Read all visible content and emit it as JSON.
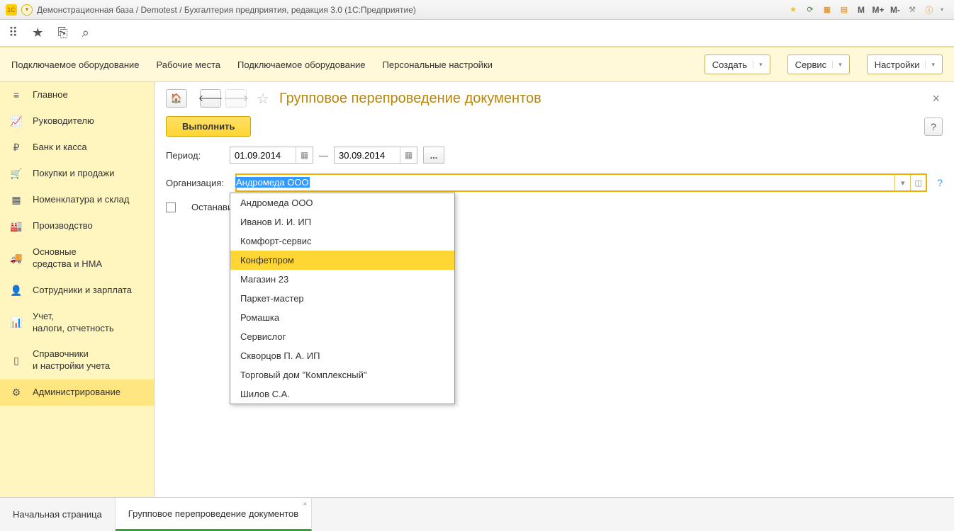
{
  "title": "Демонстрационная база / Demotest / Бухгалтерия предприятия, редакция 3.0  (1С:Предприятие)",
  "titlebar_right": {
    "m": "M",
    "mplus": "M+",
    "mminus": "M-"
  },
  "band": {
    "links": [
      "Подключаемое оборудование",
      "Рабочие места",
      "Подключаемое оборудование",
      "Персональные настройки"
    ],
    "buttons": {
      "create": "Создать",
      "service": "Сервис",
      "settings": "Настройки"
    }
  },
  "sidebar": [
    {
      "icon": "≡",
      "label": "Главное"
    },
    {
      "icon": "📈",
      "label": "Руководителю"
    },
    {
      "icon": "₽",
      "label": "Банк и касса"
    },
    {
      "icon": "🛒",
      "label": "Покупки и продажи"
    },
    {
      "icon": "▦",
      "label": "Номенклатура и склад"
    },
    {
      "icon": "🏭",
      "label": "Производство"
    },
    {
      "icon": "🚚",
      "label": "Основные\nсредства и НМА"
    },
    {
      "icon": "👤",
      "label": "Сотрудники и зарплата"
    },
    {
      "icon": "📊",
      "label": "Учет,\nналоги, отчетность"
    },
    {
      "icon": "▯",
      "label": "Справочники\nи настройки учета"
    },
    {
      "icon": "⚙",
      "label": "Администрирование"
    }
  ],
  "page": {
    "title": "Групповое перепроведение документов",
    "execute": "Выполнить",
    "help": "?",
    "period_label": "Период:",
    "date_from": "01.09.2014",
    "date_to": "30.09.2014",
    "dots": "...",
    "org_label": "Организация:",
    "org_value": "Андромеда ООО",
    "stop_label": "Останави",
    "help_q": "?"
  },
  "dropdown": {
    "items": [
      "Андромеда ООО",
      "Иванов И. И. ИП",
      "Комфорт-сервис",
      "Конфетпром",
      "Магазин 23",
      "Паркет-мастер",
      "Ромашка",
      "Сервислог",
      "Скворцов П. А. ИП",
      "Торговый дом \"Комплексный\"",
      "Шилов С.А."
    ],
    "highlighted_index": 3
  },
  "footer": {
    "tabs": [
      {
        "label": "Начальная страница",
        "active": false,
        "closable": false
      },
      {
        "label": "Групповое перепроведение документов",
        "active": true,
        "closable": true
      }
    ]
  }
}
